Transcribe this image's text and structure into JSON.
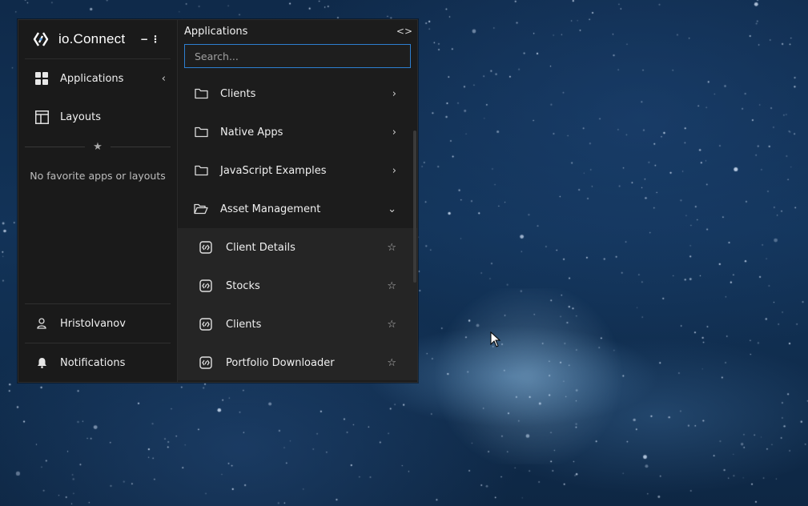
{
  "brand": {
    "name": "io.Connect",
    "minimize_label": "−",
    "menu_label": "⋮"
  },
  "sidebar": {
    "items": [
      {
        "label": "Applications",
        "icon": "grid-icon",
        "chevron": "‹"
      },
      {
        "label": "Layouts",
        "icon": "layout-icon"
      }
    ],
    "favorites_empty": "No favorite apps or layouts",
    "user": {
      "label": "HristoIvanov",
      "icon": "user-icon"
    },
    "notifications": {
      "label": "Notifications",
      "icon": "bell-icon"
    }
  },
  "panel": {
    "title": "Applications",
    "toggle_label": "<>",
    "search": {
      "placeholder": "Search...",
      "value": ""
    },
    "folders": [
      {
        "label": "Clients",
        "expanded": false
      },
      {
        "label": "Native Apps",
        "expanded": false
      },
      {
        "label": "JavaScript Examples",
        "expanded": false
      },
      {
        "label": "Asset Management",
        "expanded": true
      }
    ],
    "apps": [
      {
        "label": "Client Details"
      },
      {
        "label": "Stocks"
      },
      {
        "label": "Clients"
      },
      {
        "label": "Portfolio Downloader"
      }
    ]
  },
  "colors": {
    "accent": "#2d7fd0",
    "panel_bg": "#1c1c1c",
    "desktop_bg": "#123358"
  }
}
